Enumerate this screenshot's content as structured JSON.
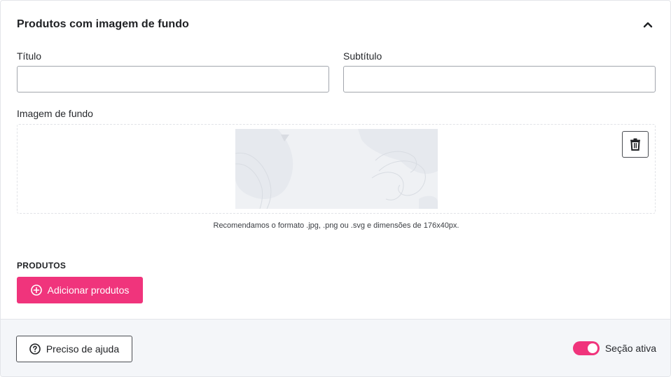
{
  "section": {
    "title": "Produtos com imagem de fundo",
    "collapse_icon": "chevron-up-icon"
  },
  "fields": {
    "title_label": "Título",
    "title_value": "",
    "subtitle_label": "Subtítulo",
    "subtitle_value": ""
  },
  "background_image": {
    "label": "Imagem de fundo",
    "delete_icon": "trash-icon",
    "hint": "Recomendamos o formato .jpg, .png ou .svg e dimensões de 176x40px."
  },
  "products": {
    "label": "PRODUTOS",
    "add_button_label": "Adicionar produtos",
    "add_icon": "plus-circle-icon"
  },
  "footer": {
    "help_button_label": "Preciso de ajuda",
    "help_icon": "question-circle-icon",
    "active_toggle_label": "Seção ativa",
    "active_toggle_on": true
  },
  "colors": {
    "accent": "#f0347c",
    "footer_bg": "#f4f6f9",
    "preview_bg": "#eff1f4"
  }
}
